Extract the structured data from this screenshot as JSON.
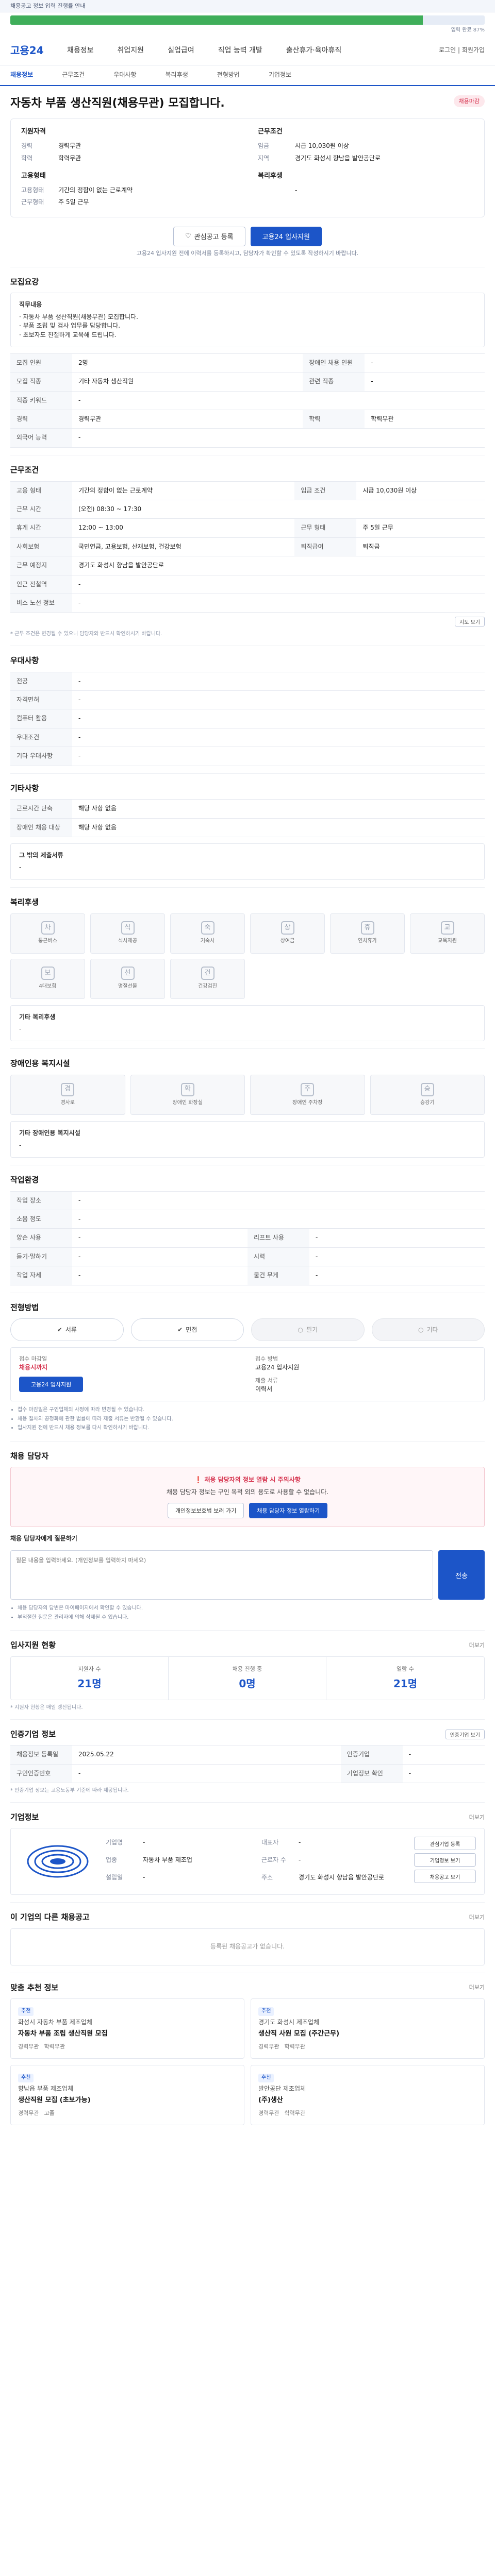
{
  "banner": {
    "text": "채용공고 정보 입력 진행률 안내"
  },
  "progress": {
    "value": 0.87,
    "meta": "입력 완료 87%"
  },
  "header": {
    "logo": "고용24",
    "menu": [
      "채용정보",
      "취업지원",
      "실업급여",
      "직업 능력 개발",
      "출산휴가·육아휴직"
    ],
    "right": "로그인 | 회원가입"
  },
  "subnav": [
    "채용정보",
    "근무조건",
    "우대사항",
    "복리후생",
    "전형방법",
    "기업정보"
  ],
  "title": {
    "text": "자동차 부품 생산직원(채용무관) 모집합니다.",
    "badge": "채용마감"
  },
  "summary": {
    "qualification_title": "지원자격",
    "qualification": [
      {
        "k": "경력",
        "v": "경력무관"
      },
      {
        "k": "학력",
        "v": "학력무관"
      }
    ],
    "condition_title": "근무조건",
    "condition": [
      {
        "k": "임금",
        "v": "시급 10,030원 이상"
      },
      {
        "k": "지역",
        "v": "경기도 화성시 향남읍 발안공단로"
      }
    ],
    "employ_title": "고용형태",
    "employ": [
      {
        "k": "고용형태",
        "v": "기간의 정함이 없는 근로계약"
      },
      {
        "k": "근무형태",
        "v": "주 5일 근무"
      }
    ],
    "welfare_title": "복리후생",
    "welfare": [
      {
        "k": "",
        "v": "-"
      }
    ]
  },
  "apply": {
    "scrap": "관심공고 등록",
    "apply": "고용24 입사지원",
    "note": "고용24 입사지원 전에 이력서를 등록하시고, 담당자가 확인할 수 있도록 작성하시기 바랍니다."
  },
  "job_detail": {
    "title": "모집요강",
    "box_title": "직무내용",
    "box_lines": [
      "· 자동차 부품 생산직원(채용무관) 모집합니다.",
      "· 부품 조립 및 검사 업무를 담당합니다.",
      "· 초보자도 친절하게 교육해 드립니다."
    ],
    "rows": [
      {
        "k": "모집 인원",
        "v": "2명",
        "k2": "장애인 채용 인원",
        "v2": "-"
      },
      {
        "k": "모집 직종",
        "v": "기타 자동차 생산직원",
        "k2": "관련 직종",
        "v2": "-"
      },
      {
        "k": "직종 키워드",
        "v": "-",
        "k2": "",
        "v2": ""
      },
      {
        "k": "경력",
        "v": "경력무관",
        "k2": "학력",
        "v2": "학력무관"
      },
      {
        "k": "외국어 능력",
        "v": "-",
        "k2": "",
        "v2": ""
      }
    ]
  },
  "work": {
    "title": "근무조건",
    "rows": [
      {
        "k": "고용 형태",
        "v": "기간의 정함이 없는 근로계약",
        "k2": "임금 조건",
        "v2": "시급 10,030원 이상"
      },
      {
        "k": "근무 시간",
        "v": "(오전) 08:30 ~ 17:30",
        "k2": "",
        "v2": ""
      },
      {
        "k": "휴게 시간",
        "v": "12:00 ~ 13:00",
        "k2": "근무 형태",
        "v2": "주 5일 근무"
      },
      {
        "k": "사회보험",
        "v": "국민연금, 고용보험, 산재보험, 건강보험",
        "k2": "퇴직급여",
        "v2": "퇴직금"
      },
      {
        "k": "근무 예정지",
        "v": "경기도 화성시 향남읍 발안공단로",
        "k2": "",
        "v2": ""
      },
      {
        "k": "인근 전철역",
        "v": "-",
        "k2": "",
        "v2": ""
      },
      {
        "k": "버스 노선 정보",
        "v": "-",
        "k2": "",
        "v2": ""
      }
    ],
    "map_btn": "지도 보기",
    "note": "* 근무 조건은 변경될 수 있으니 담당자와 반드시 확인하시기 바랍니다."
  },
  "preferred": {
    "title": "우대사항",
    "rows": [
      {
        "k": "전공",
        "v": "-"
      },
      {
        "k": "자격면허",
        "v": "-"
      },
      {
        "k": "컴퓨터 활용",
        "v": "-"
      },
      {
        "k": "우대조건",
        "v": "-"
      },
      {
        "k": "기타 우대사항",
        "v": "-"
      }
    ]
  },
  "etc": {
    "title": "기타사항",
    "rows": [
      {
        "k": "근로시간 단축",
        "v": "해당 사항 없음"
      },
      {
        "k": "장애인 채용 대상",
        "v": "해당 사항 없음"
      }
    ],
    "box_title": "그 밖의 제출서류",
    "box_text": "-"
  },
  "benefits": {
    "title": "복리후생",
    "items": [
      {
        "icon": "car-icon",
        "glyph": "차",
        "label": "통근버스"
      },
      {
        "icon": "meal-icon",
        "glyph": "식",
        "label": "식사제공"
      },
      {
        "icon": "dorm-icon",
        "glyph": "숙",
        "label": "기숙사"
      },
      {
        "icon": "bonus-icon",
        "glyph": "상",
        "label": "상여금"
      },
      {
        "icon": "vacation-icon",
        "glyph": "휴",
        "label": "연차휴가"
      },
      {
        "icon": "education-icon",
        "glyph": "교",
        "label": "교육지원"
      },
      {
        "icon": "insurance-icon",
        "glyph": "보",
        "label": "4대보험"
      },
      {
        "icon": "gift-icon",
        "glyph": "선",
        "label": "명절선물"
      },
      {
        "icon": "health-icon",
        "glyph": "건",
        "label": "건강검진"
      }
    ],
    "box_title": "기타 복리후생",
    "box_text": "-"
  },
  "disability": {
    "title": "장애인용 복지시설",
    "items": [
      {
        "icon": "ramp-icon",
        "glyph": "경",
        "label": "경사로"
      },
      {
        "icon": "toilet-icon",
        "glyph": "화",
        "label": "장애인 화장실"
      },
      {
        "icon": "parking-icon",
        "glyph": "주",
        "label": "장애인 주차장"
      },
      {
        "icon": "elevator-icon",
        "glyph": "승",
        "label": "승강기"
      }
    ],
    "box_title": "기타 장애인용 복지시설",
    "box_text": "-"
  },
  "company_support": {
    "title": "작업환경",
    "rows": [
      {
        "k": "작업 장소",
        "v": "-",
        "k2": "",
        "v2": ""
      },
      {
        "k": "소음 정도",
        "v": "-",
        "k2": "",
        "v2": ""
      },
      {
        "k": "양손 사용",
        "v": "-",
        "k2": "리프트 사용",
        "v2": "-"
      },
      {
        "k": "듣기·말하기",
        "v": "-",
        "k2": "시력",
        "v2": "-"
      },
      {
        "k": "작업 자세",
        "v": "-",
        "k2": "물건 무게",
        "v2": "-"
      }
    ]
  },
  "procedure": {
    "title": "전형방법",
    "steps": [
      {
        "label": "서류",
        "on": true
      },
      {
        "label": "면접",
        "on": true
      },
      {
        "label": "필기",
        "on": false
      },
      {
        "label": "기타",
        "on": false
      }
    ],
    "box": {
      "deadline_label": "접수 마감일",
      "deadline": "채용시까지",
      "method_label": "접수 방법",
      "method": "고용24 입사지원",
      "submit_label": "제출 서류",
      "submit": "이력서",
      "btn": "고용24 입사지원"
    },
    "bullets": [
      "접수 마감일은 구인업체의 사정에 따라 변경될 수 있습니다.",
      "채용 절차의 공정화에 관한 법률에 따라 제출 서류는 반환될 수 있습니다.",
      "입사지원 전에 반드시 채용 정보를 다시 확인하시기 바랍니다."
    ]
  },
  "manager": {
    "title": "채용 담당자",
    "alert_title": "채용 담당자의 정보 열람 시 주의사항",
    "alert_text": "채용 담당자 정보는 구인 목적 외의 용도로 사용할 수 없습니다.",
    "btn1": "개인정보보호법 보러 가기",
    "btn2": "채용 담당자 정보 열람하기",
    "qa_title": "채용 담당자에게 질문하기",
    "qa_placeholder": "질문 내용을 입력하세요. (개인정보를 입력하지 마세요)",
    "send": "전송",
    "bullets": [
      "채용 담당자의 답변은 마이페이지에서 확인할 수 있습니다.",
      "부적절한 질문은 관리자에 의해 삭제될 수 있습니다."
    ]
  },
  "stats": {
    "title": "입사지원 현황",
    "more": "더보기",
    "items": [
      {
        "label": "지원자 수",
        "value": "21명"
      },
      {
        "label": "채용 진행 중",
        "value": "0명"
      },
      {
        "label": "열람 수",
        "value": "21명"
      }
    ],
    "note": "* 지원자 현황은 매일 갱신됩니다."
  },
  "job_info": {
    "title": "인증기업 정보",
    "btn": "인증기업 보기",
    "rows": [
      {
        "k": "채용정보 등록일",
        "v": "2025.05.22",
        "k2": "인증기업",
        "v2": "-"
      },
      {
        "k": "구인인증번호",
        "v": "-",
        "k2": "기업정보 확인",
        "v2": "-"
      }
    ],
    "note": "* 인증기업 정보는 고용노동부 기준에 따라 제공됩니다."
  },
  "company": {
    "title": "기업정보",
    "more": "더보기",
    "logo_text": "LOGO",
    "rows": [
      {
        "k": "기업명",
        "v": "-"
      },
      {
        "k": "대표자",
        "v": "-"
      },
      {
        "k": "업종",
        "v": "자동차 부품 제조업"
      },
      {
        "k": "근로자 수",
        "v": "-"
      },
      {
        "k": "설립일",
        "v": "-"
      },
      {
        "k": "주소",
        "v": "경기도 화성시 향남읍 발안공단로"
      }
    ],
    "side_btns": [
      "관심기업 등록",
      "기업정보 보기",
      "채용공고 보기"
    ]
  },
  "other_jobs": {
    "title": "이 기업의 다른 채용공고",
    "more": "더보기",
    "empty": "등록된 채용공고가 없습니다."
  },
  "recommended": {
    "title": "맞춤 추천 정보",
    "more": "더보기",
    "cards": [
      {
        "tag": "추천",
        "name": "화성시 자동차 부품 제조업체",
        "title": "자동차 부품 조립 생산직원 모집",
        "meta1": "경력무관",
        "meta2": "학력무관"
      },
      {
        "tag": "추천",
        "name": "경기도 화성시 제조업체",
        "title": "생산직 사원 모집 (주간근무)",
        "meta1": "경력무관",
        "meta2": "학력무관"
      },
      {
        "tag": "추천",
        "name": "향남읍 부품 제조업체",
        "title": "생산직원 모집 (초보가능)",
        "meta1": "경력무관",
        "meta2": "고졸"
      },
      {
        "tag": "추천",
        "name": "발안공단 제조업체",
        "title": "(주)생산",
        "meta1": "경력무관",
        "meta2": "학력무관"
      }
    ]
  }
}
